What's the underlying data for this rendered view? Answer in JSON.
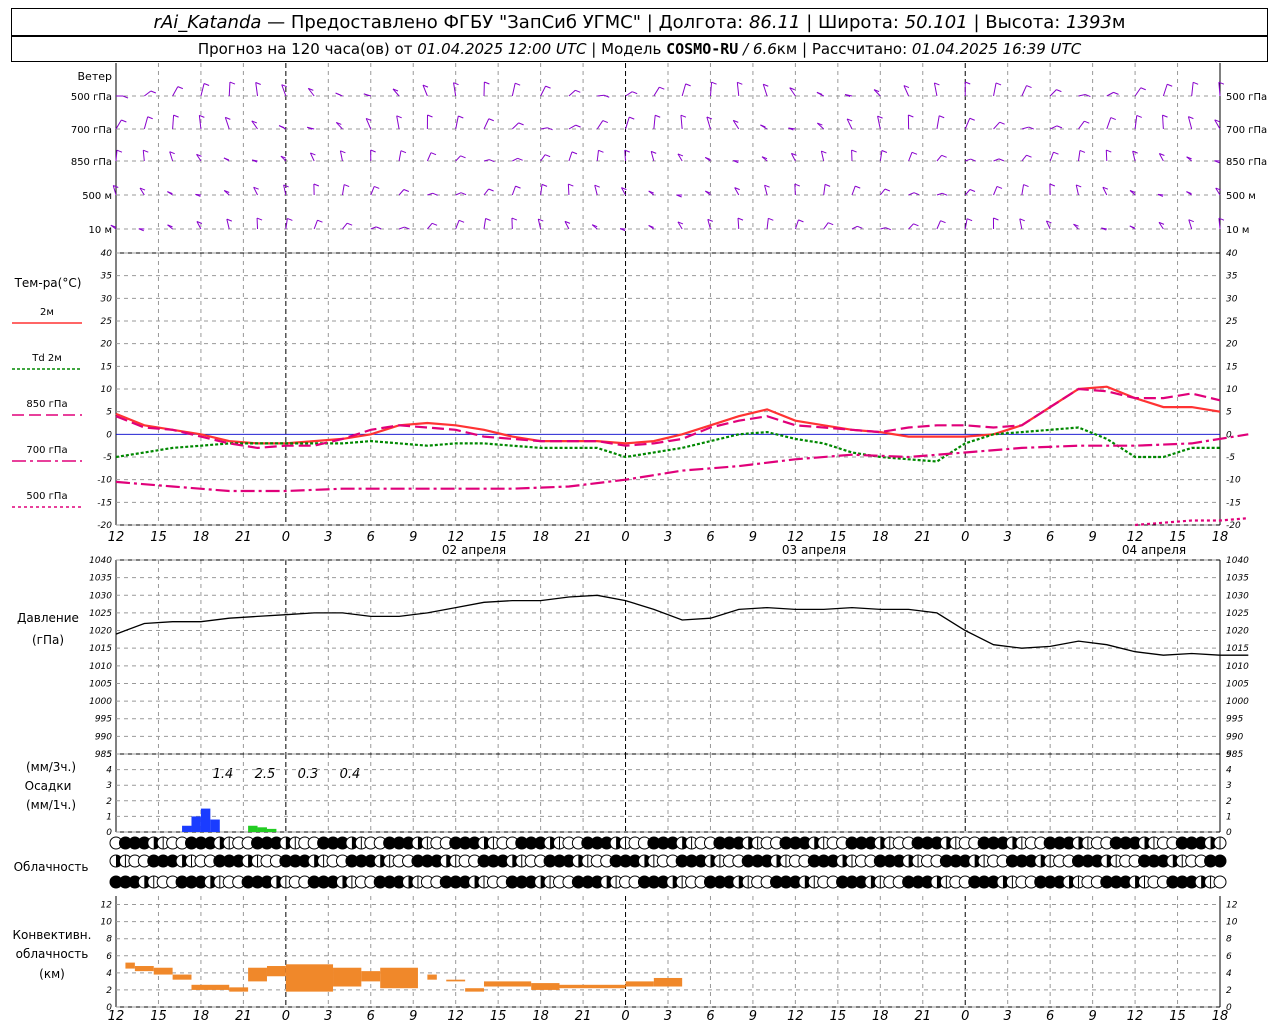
{
  "header": {
    "station": "rAi_Katanda",
    "dash": "—",
    "provider": "Предоставлено ФГБУ \"ЗапСиб УГМС\"",
    "lon_label": "Долгота:",
    "lon_value": "86.11",
    "lat_label": "Широта:",
    "lat_value": "50.101",
    "alt_label": "Высота:",
    "alt_value": "1393",
    "alt_unit": "м",
    "sep": "|",
    "forecast_prefix": "Прогноз на 120 часа(ов) от",
    "forecast_start": "01.04.2025 12:00 UTC",
    "model_label": "Модель",
    "model_name": "COSMO-RU",
    "model_res": "/ 6.6",
    "model_res_unit": "км",
    "computed_label": "Рассчитано:",
    "computed_value": "01.04.2025 16:39 UTC"
  },
  "wind_panel": {
    "title": "Ветер",
    "levels": [
      "500 гПа",
      "700 гПа",
      "850 гПа",
      "500 м",
      "10  м"
    ]
  },
  "temp_panel": {
    "title": "Тем-ра(°C)",
    "legend": [
      {
        "label": "2м",
        "color": "#ff3333",
        "dash": ""
      },
      {
        "label": "2м",
        "prefix": "Td",
        "color": "#008800",
        "dash": "3,2"
      },
      {
        "label": "850 гПа",
        "color": "#e0007a",
        "dash": "12,5"
      },
      {
        "label": "700 гПа",
        "color": "#e0007a",
        "dash": "14,4,3,4"
      },
      {
        "label": "500 гПа",
        "color": "#e0007a",
        "dash": "3,3"
      }
    ]
  },
  "pressure_panel": {
    "title": "Давление",
    "unit": "(гПа)"
  },
  "precip_panel": {
    "unit_top": "(мм/3ч.)",
    "title": "Осадки",
    "unit_bottom": "(мм/1ч.)",
    "totals": [
      "1.4",
      "2.5",
      "0.3",
      "0.4"
    ]
  },
  "cloud_panel": {
    "title": "Облачность"
  },
  "convective_panel": {
    "title_line1": "Конвективн.",
    "title_line2": "облачность",
    "unit": "(км)"
  },
  "time_axis": {
    "hour_labels": [
      "12",
      "15",
      "18",
      "21",
      "0",
      "3",
      "6",
      "9",
      "12",
      "15",
      "18",
      "21",
      "0",
      "3",
      "6",
      "9",
      "12",
      "15",
      "18",
      "21",
      "0",
      "3",
      "6",
      "9",
      "12",
      "15",
      "18"
    ],
    "day_labels": [
      "02 апреля",
      "03 апреля",
      "04 апреля"
    ]
  },
  "colors": {
    "t2m": "#ff3333",
    "td2m": "#008800",
    "t_upper": "#e0007a",
    "wind": "#8800cc",
    "pressure": "#000000",
    "precip_rain": "#1a3cff",
    "precip_light": "#22cc22",
    "convective": "#f0882a",
    "grid": "#999999"
  },
  "chart_data": [
    {
      "type": "line",
      "title": "Тем-ра(°C)",
      "x_hours": [
        0,
        3,
        6,
        9,
        12,
        15,
        18,
        21,
        24,
        27,
        30,
        33,
        36,
        39,
        42,
        45,
        48,
        51,
        54,
        57,
        60,
        63,
        66,
        69,
        72,
        75,
        78,
        81,
        84,
        87,
        90,
        93,
        96,
        99,
        102,
        105,
        108,
        111,
        114,
        117,
        120,
        123,
        126,
        129,
        132,
        135,
        138,
        141,
        144,
        147,
        150,
        153,
        156,
        159,
        162,
        165,
        168,
        171,
        174,
        177,
        180,
        183,
        186,
        189,
        192,
        195,
        198,
        201,
        204,
        207,
        210,
        213,
        216,
        219,
        222,
        225,
        228,
        231,
        234
      ],
      "x_hours_note_unused": "",
      "ylim": [
        -20,
        40
      ],
      "y_ticks": [
        -20,
        -15,
        -10,
        -5,
        0,
        5,
        10,
        15,
        20,
        25,
        30,
        35,
        40
      ],
      "series": [
        {
          "name": "2м",
          "hours": [
            0,
            3,
            6,
            9,
            12,
            15,
            18,
            21,
            24,
            27,
            30,
            33,
            36,
            39,
            42,
            45,
            48,
            51,
            54,
            57,
            60,
            63,
            66,
            69,
            72,
            75,
            78,
            81,
            84,
            87,
            90,
            93,
            96,
            99,
            102,
            105,
            108,
            111,
            114,
            117
          ],
          "values": [
            4.5,
            2,
            1,
            0,
            -1.5,
            -2,
            -2,
            -1.5,
            -1,
            0,
            2,
            2.5,
            2,
            1,
            -0.5,
            -1.5,
            -1.5,
            -1.5,
            -2,
            -1.5,
            0,
            2,
            4,
            5.5,
            3,
            2,
            1,
            0.5,
            -0.5,
            -0.5,
            -0.5,
            0,
            2,
            6,
            10,
            10.5,
            8,
            6,
            6,
            5
          ]
        },
        {
          "name": "Td 2м",
          "hours": [
            0,
            3,
            6,
            9,
            12,
            15,
            18,
            21,
            24,
            27,
            30,
            33,
            36,
            39,
            42,
            45,
            48,
            51,
            54,
            57,
            60,
            63,
            66,
            69,
            72,
            75,
            78,
            81,
            84,
            87,
            90,
            93,
            96,
            99,
            102,
            105,
            108,
            111,
            114,
            117
          ],
          "values": [
            -5,
            -4,
            -3,
            -2.5,
            -2,
            -2,
            -2,
            -2,
            -2,
            -1.5,
            -2,
            -2.5,
            -2,
            -2,
            -2.5,
            -3,
            -3,
            -3,
            -5,
            -4,
            -3,
            -1.5,
            0,
            0.5,
            -1,
            -2,
            -4,
            -5,
            -5.5,
            -6,
            -2,
            0,
            0.5,
            1,
            1.5,
            -1,
            -5,
            -5,
            -3,
            -3
          ]
        },
        {
          "name": "850 гПа",
          "hours": [
            0,
            3,
            6,
            9,
            12,
            15,
            18,
            21,
            24,
            27,
            30,
            33,
            36,
            39,
            42,
            45,
            48,
            51,
            54,
            57,
            60,
            63,
            66,
            69,
            72,
            75,
            78,
            81,
            84,
            87,
            90,
            93,
            96,
            99,
            102,
            105,
            108,
            111,
            114,
            117
          ],
          "values": [
            4,
            1.5,
            1,
            -0.5,
            -2,
            -3,
            -2.5,
            -2.5,
            -1,
            1,
            2,
            1.5,
            1,
            -0.5,
            -1,
            -1.5,
            -1.5,
            -1.5,
            -2.5,
            -2,
            -1,
            1.5,
            3,
            4,
            2,
            1.5,
            1,
            0.5,
            1.5,
            2,
            2,
            1.5,
            2,
            6,
            10,
            9.5,
            8,
            8,
            9,
            7.5
          ]
        },
        {
          "name": "700 гПа",
          "hours": [
            0,
            6,
            12,
            18,
            24,
            30,
            36,
            42,
            48,
            54,
            60,
            66,
            72,
            78,
            84,
            90,
            96,
            102,
            108,
            114,
            120
          ],
          "values": [
            -10.5,
            -11.5,
            -12.5,
            -12.5,
            -12,
            -12,
            -12,
            -12,
            -11.5,
            -10,
            -8,
            -7,
            -5.5,
            -4.5,
            -5,
            -4,
            -3,
            -2.5,
            -2.5,
            -2,
            0
          ]
        },
        {
          "name": "500 гПа",
          "hours": [
            108,
            111,
            114,
            117,
            120
          ],
          "values": [
            -20,
            -19.5,
            -19,
            -19,
            -18.5
          ]
        }
      ],
      "xlabel": "",
      "ylabel": "Тем-ра(°C)"
    },
    {
      "type": "line",
      "title": "Давление",
      "ylabel": "(гПа)",
      "ylim": [
        985,
        1040
      ],
      "y_ticks": [
        985,
        990,
        995,
        1000,
        1005,
        1010,
        1015,
        1020,
        1025,
        1030,
        1035,
        1040
      ],
      "series": [
        {
          "name": "",
          "hours": [
            0,
            3,
            6,
            9,
            12,
            15,
            18,
            21,
            24,
            27,
            30,
            33,
            36,
            39,
            42,
            45,
            48,
            51,
            54,
            57,
            60,
            63,
            66,
            69,
            72,
            75,
            78,
            81,
            84,
            87,
            90,
            93,
            96,
            99,
            102,
            105,
            108,
            111,
            114,
            117,
            120
          ],
          "values": [
            1019,
            1022,
            1022.5,
            1022.5,
            1023.5,
            1024,
            1024.5,
            1025,
            1025,
            1024,
            1024,
            1025,
            1026.5,
            1028,
            1028.5,
            1028.5,
            1029.5,
            1030,
            1028.5,
            1026,
            1023,
            1023.5,
            1026,
            1026.5,
            1026,
            1026,
            1026.5,
            1026,
            1026,
            1025,
            1020,
            1016,
            1015,
            1015.5,
            1017,
            1016,
            1014,
            1013,
            1013.5,
            1013,
            1013
          ]
        }
      ]
    },
    {
      "type": "bar",
      "title": "Осадки",
      "ylabel": "(мм/1ч.)",
      "ylim": [
        0,
        5
      ],
      "hours": [
        8,
        9,
        10,
        11,
        12,
        13,
        14,
        15,
        16,
        17
      ],
      "values": [
        0.4,
        1.0,
        1.5,
        0.8,
        0,
        0,
        0,
        0.4,
        0.3,
        0.2
      ],
      "colors_by_index": [
        "#1a3cff",
        "#1a3cff",
        "#1a3cff",
        "#1a3cff",
        "",
        "",
        "",
        "#22cc22",
        "#22cc22",
        "#22cc22"
      ],
      "totals_3h": [
        "1.4",
        "2.5",
        "0.3",
        "0.4"
      ]
    },
    {
      "type": "bar",
      "title": "Конвективн. облачность",
      "ylabel": "(км)",
      "ylim": [
        0,
        13
      ],
      "segments_km": [
        {
          "from_h": 1,
          "to_h": 2,
          "bottom": 4.5,
          "top": 5.2
        },
        {
          "from_h": 2,
          "to_h": 4,
          "bottom": 4.2,
          "top": 4.8
        },
        {
          "from_h": 4,
          "to_h": 6,
          "bottom": 3.8,
          "top": 4.6
        },
        {
          "from_h": 6,
          "to_h": 8,
          "bottom": 3.2,
          "top": 3.8
        },
        {
          "from_h": 8,
          "to_h": 12,
          "bottom": 2.0,
          "top": 2.6
        },
        {
          "from_h": 12,
          "to_h": 14,
          "bottom": 1.8,
          "top": 2.3
        },
        {
          "from_h": 14,
          "to_h": 16,
          "bottom": 3.0,
          "top": 4.6
        },
        {
          "from_h": 16,
          "to_h": 18,
          "bottom": 3.6,
          "top": 4.8
        },
        {
          "from_h": 18,
          "to_h": 23,
          "bottom": 1.8,
          "top": 5.0
        },
        {
          "from_h": 23,
          "to_h": 26,
          "bottom": 2.4,
          "top": 4.6
        },
        {
          "from_h": 26,
          "to_h": 28,
          "bottom": 3.0,
          "top": 4.2
        },
        {
          "from_h": 28,
          "to_h": 32,
          "bottom": 2.2,
          "top": 4.6
        },
        {
          "from_h": 33,
          "to_h": 34,
          "bottom": 3.2,
          "top": 3.8
        },
        {
          "from_h": 35,
          "to_h": 37,
          "bottom": 3.0,
          "top": 3.2
        },
        {
          "from_h": 37,
          "to_h": 39,
          "bottom": 1.8,
          "top": 2.2
        },
        {
          "from_h": 39,
          "to_h": 44,
          "bottom": 2.4,
          "top": 3.0
        },
        {
          "from_h": 44,
          "to_h": 47,
          "bottom": 2.0,
          "top": 2.8
        },
        {
          "from_h": 47,
          "to_h": 54,
          "bottom": 2.2,
          "top": 2.6
        },
        {
          "from_h": 54,
          "to_h": 57,
          "bottom": 2.4,
          "top": 3.0
        },
        {
          "from_h": 57,
          "to_h": 60,
          "bottom": 2.4,
          "top": 3.4
        }
      ]
    }
  ]
}
